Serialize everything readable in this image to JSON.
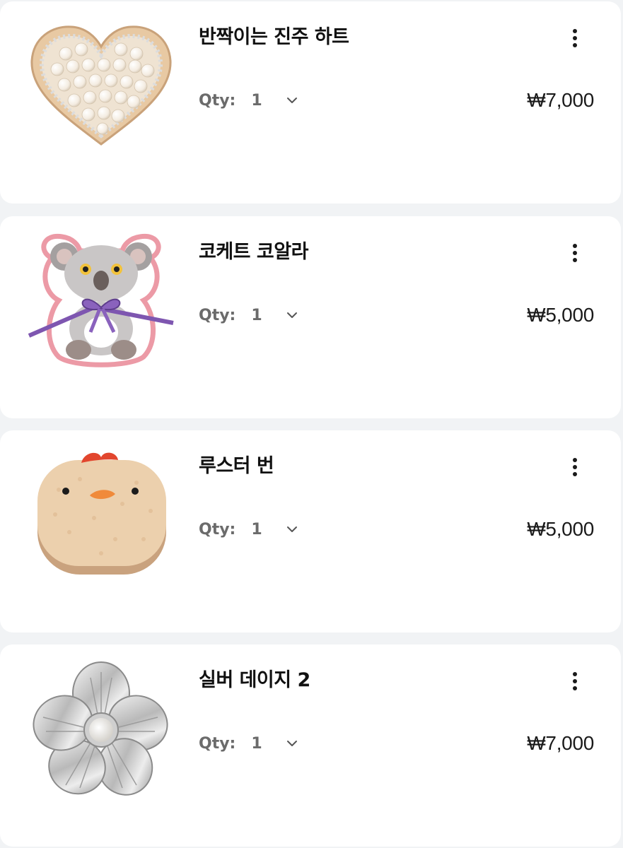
{
  "cart": {
    "qty_label": "Qty:",
    "items": [
      {
        "name": "반짝이는 진주 하트",
        "qty": "1",
        "price": "₩7,000",
        "image": "pearl-heart-charm"
      },
      {
        "name": "코케트 코알라",
        "qty": "1",
        "price": "₩5,000",
        "image": "koala-charm"
      },
      {
        "name": "루스터 번",
        "qty": "1",
        "price": "₩5,000",
        "image": "rooster-bun-charm"
      },
      {
        "name": "실버 데이지 2",
        "qty": "1",
        "price": "₩7,000",
        "image": "silver-daisy-charm"
      }
    ]
  },
  "colors": {
    "background": "#f1f3f5",
    "card": "#ffffff",
    "text": "#111111",
    "muted": "#6b6b6b"
  }
}
